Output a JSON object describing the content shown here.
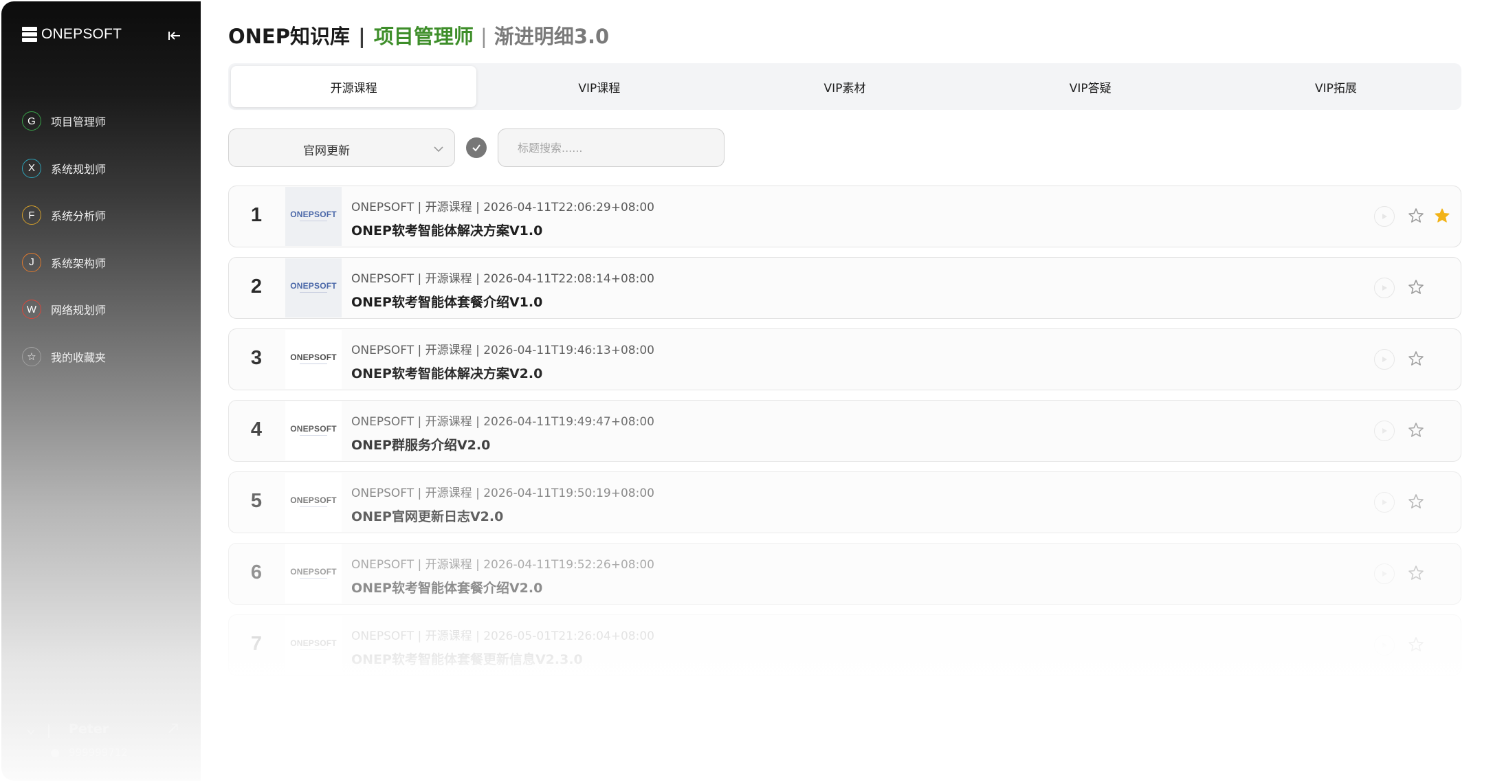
{
  "sidebar": {
    "brand": "ONEPSOFT",
    "nav": [
      {
        "badge": "G",
        "label": "项目管理师",
        "badge_color": "#3aa24a"
      },
      {
        "badge": "X",
        "label": "系统规划师",
        "badge_color": "#2ea3b8"
      },
      {
        "badge": "F",
        "label": "系统分析师",
        "badge_color": "#d5a02b"
      },
      {
        "badge": "J",
        "label": "系统架构师",
        "badge_color": "#e07a2e"
      },
      {
        "badge": "W",
        "label": "网络规划师",
        "badge_color": "#d9473b"
      },
      {
        "badge": "☆",
        "label": "我的收藏夹",
        "badge_color": "#a0a0a0"
      }
    ],
    "user": {
      "name": "Peter",
      "id": "999999712"
    }
  },
  "header": {
    "brand_title": "ONEP知识库",
    "divider": "|",
    "section": "项目管理师",
    "divider2": "|",
    "subtitle": "渐进明细3.0"
  },
  "tabs": [
    {
      "label": "开源课程",
      "active": true
    },
    {
      "label": "VIP课程",
      "active": false
    },
    {
      "label": "VIP素材",
      "active": false
    },
    {
      "label": "VIP答疑",
      "active": false
    },
    {
      "label": "VIP拓展",
      "active": false
    }
  ],
  "filters": {
    "select_value": "官网更新",
    "search_placeholder": "标题搜索......"
  },
  "items": [
    {
      "index": "1",
      "logo": "ONEPSOFT",
      "meta": "ONEPSOFT | 开源课程 | 2026-04-11T22:06:29+08:00",
      "title": "ONEP软考智能体解决方案V1.0",
      "favorited": true
    },
    {
      "index": "2",
      "logo": "ONEPSOFT",
      "meta": "ONEPSOFT | 开源课程 | 2026-04-11T22:08:14+08:00",
      "title": "ONEP软考智能体套餐介绍V1.0",
      "favorited": false
    },
    {
      "index": "3",
      "logo": "ONEPSOFT",
      "meta": "ONEPSOFT | 开源课程 | 2026-04-11T19:46:13+08:00",
      "title": "ONEP软考智能体解决方案V2.0",
      "favorited": false
    },
    {
      "index": "4",
      "logo": "ONEPSOFT",
      "meta": "ONEPSOFT | 开源课程 | 2026-04-11T19:49:47+08:00",
      "title": "ONEP群服务介绍V2.0",
      "favorited": false
    },
    {
      "index": "5",
      "logo": "ONEPSOFT",
      "meta": "ONEPSOFT | 开源课程 | 2026-04-11T19:50:19+08:00",
      "title": "ONEP官网更新日志V2.0",
      "favorited": false
    },
    {
      "index": "6",
      "logo": "ONEPSOFT",
      "meta": "ONEPSOFT | 开源课程 | 2026-04-11T19:52:26+08:00",
      "title": "ONEP软考智能体套餐介绍V2.0",
      "favorited": false
    },
    {
      "index": "7",
      "logo": "ONEPSOFT",
      "meta": "ONEPSOFT | 开源课程 | 2026-05-01T21:26:04+08:00",
      "title": "ONEP软考智能体套餐更新信息V2.3.0",
      "favorited": false
    }
  ],
  "colors": {
    "accent_green": "#3e8e2a",
    "star_filled": "#f2b318",
    "star_outline": "#9a9a9a"
  }
}
